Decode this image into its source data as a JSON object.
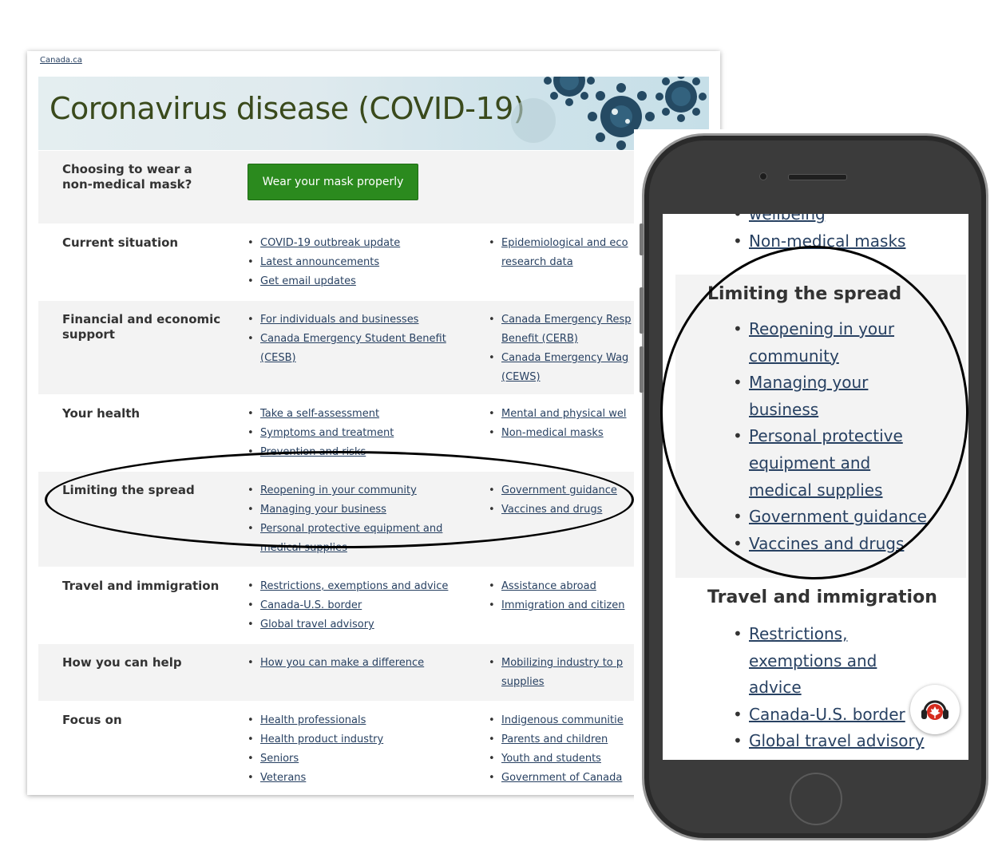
{
  "desktop": {
    "breadcrumb": "Canada.ca",
    "banner_title": "Coronavirus disease (COVID-19)",
    "mask_row": {
      "label": "Choosing to wear a non-medical mask?",
      "button": "Wear your mask properly"
    },
    "rows": {
      "current": {
        "label": "Current situation",
        "col1": [
          "COVID-19 outbreak update",
          "Latest announcements",
          "Get email updates"
        ],
        "col2": [
          "Epidemiological and eco",
          "research data"
        ]
      },
      "financial": {
        "label": "Financial and economic support",
        "col1": [
          "For individuals and businesses",
          "Canada Emergency Student Benefit",
          "(CESB)"
        ],
        "col2": [
          "Canada Emergency Resp",
          "Benefit (CERB)",
          "Canada Emergency Wag",
          "(CEWS)"
        ]
      },
      "health": {
        "label": "Your health",
        "col1": [
          "Take a self-assessment",
          "Symptoms and treatment",
          "Prevention and risks"
        ],
        "col2": [
          "Mental and physical wel",
          "Non-medical masks"
        ]
      },
      "limiting": {
        "label": "Limiting the spread",
        "col1": [
          "Reopening in your community",
          "Managing your business",
          "Personal protective equipment and",
          "medical supplies"
        ],
        "col2": [
          "Government guidance",
          "Vaccines and drugs"
        ]
      },
      "travel": {
        "label": "Travel and immigration",
        "col1": [
          "Restrictions, exemptions and advice",
          "Canada-U.S. border",
          "Global travel advisory"
        ],
        "col2": [
          "Assistance abroad",
          "Immigration and citizen"
        ]
      },
      "help": {
        "label": "How you can help",
        "col1": [
          "How you can make a difference"
        ],
        "col2": [
          "Mobilizing industry to p",
          "supplies"
        ]
      },
      "focus": {
        "label": "Focus on",
        "col1": [
          "Health professionals",
          "Health product industry",
          "Seniors",
          "Veterans"
        ],
        "col2": [
          "Indigenous communitie",
          "Parents and children",
          "Youth and students",
          "Government of Canada"
        ]
      }
    }
  },
  "mobile": {
    "top_partial": "wellbeing",
    "top_item": "Non-medical masks",
    "limiting_heading": "Limiting the spread",
    "limiting_lines": [
      "Reopening in your",
      "community",
      "Managing your",
      "business",
      "Personal protective",
      "equipment and",
      "medical supplies",
      "Government guidance",
      "Vaccines and drugs"
    ],
    "travel_heading": "Travel and immigration",
    "travel_lines": [
      "Restrictions,",
      "exemptions and",
      "advice",
      "Canada-U.S. border",
      "Global travel advisory"
    ]
  },
  "icons": {
    "virus": "virus-icon",
    "help": "canada-helpdesk-icon"
  },
  "colors": {
    "link": "#284162",
    "button_green": "#2b8a1e",
    "banner_title": "#3a4a1c"
  }
}
